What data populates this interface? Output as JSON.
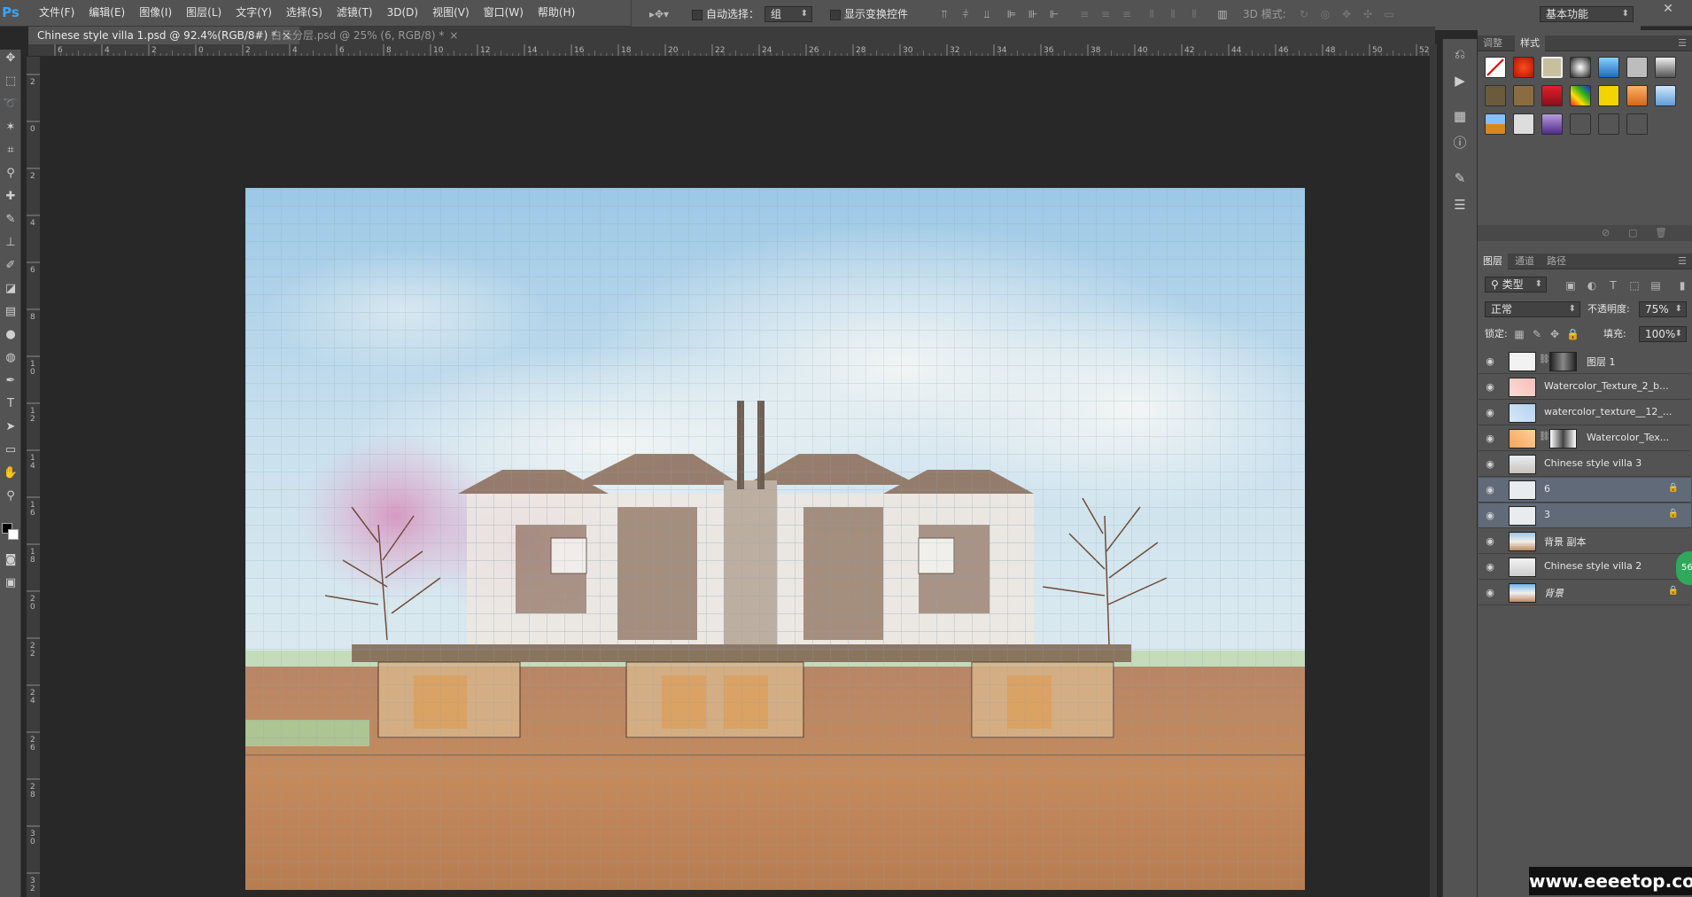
{
  "app": {
    "logo": "Ps"
  },
  "menu": [
    "文件(F)",
    "编辑(E)",
    "图像(I)",
    "图层(L)",
    "文字(Y)",
    "选择(S)",
    "滤镜(T)",
    "3D(D)",
    "视图(V)",
    "窗口(W)",
    "帮助(H)"
  ],
  "options": {
    "auto_select_label": "自动选择：",
    "auto_select_value": "组",
    "show_transform_label": "显示变换控件",
    "mode3d_label": "3D 模式:",
    "workspace": "基本功能"
  },
  "tabs": [
    {
      "label": "Chinese style villa 1.psd @ 92.4%(RGB/8#) *",
      "close": "×"
    },
    {
      "label": "白云分层.psd @ 25% (6, RGB/8) *",
      "close": "×"
    }
  ],
  "ruler_top": [
    "6",
    "4",
    "2",
    "0",
    "2",
    "4",
    "6",
    "8",
    "10",
    "12",
    "14",
    "16",
    "18",
    "20",
    "22",
    "24",
    "26",
    "28",
    "30",
    "32",
    "34",
    "36",
    "38",
    "40",
    "42",
    "44",
    "46",
    "48",
    "50",
    "52"
  ],
  "ruler_left": [
    "2",
    "0",
    "2",
    "4",
    "6",
    "8",
    "1\n0",
    "1\n2",
    "1\n4",
    "1\n6",
    "1\n8",
    "2\n0",
    "2\n2",
    "2\n4",
    "2\n6",
    "2\n8",
    "3\n0",
    "3\n2"
  ],
  "panel_top_tabs": [
    "调整",
    "样式"
  ],
  "layers_tabs": [
    "图层",
    "通道",
    "路径"
  ],
  "layers": {
    "filter_kind": "类型",
    "blend_mode": "正常",
    "opacity_label": "不透明度:",
    "opacity_value": "75%",
    "lock_label": "锁定:",
    "fill_label": "填充:",
    "fill_value": "100%",
    "rows": [
      {
        "name": "图层 1"
      },
      {
        "name": "Watercolor_Texture_2_b..."
      },
      {
        "name": "watercolor_texture__12_..."
      },
      {
        "name": "Watercolor_Tex..."
      },
      {
        "name": "Chinese style villa 3"
      },
      {
        "name": "6"
      },
      {
        "name": "3"
      },
      {
        "name": "背景 副本"
      },
      {
        "name": "Chinese style villa 2"
      },
      {
        "name": "背景"
      }
    ]
  },
  "badge": "56",
  "watermark": "www.eeeetop.com"
}
